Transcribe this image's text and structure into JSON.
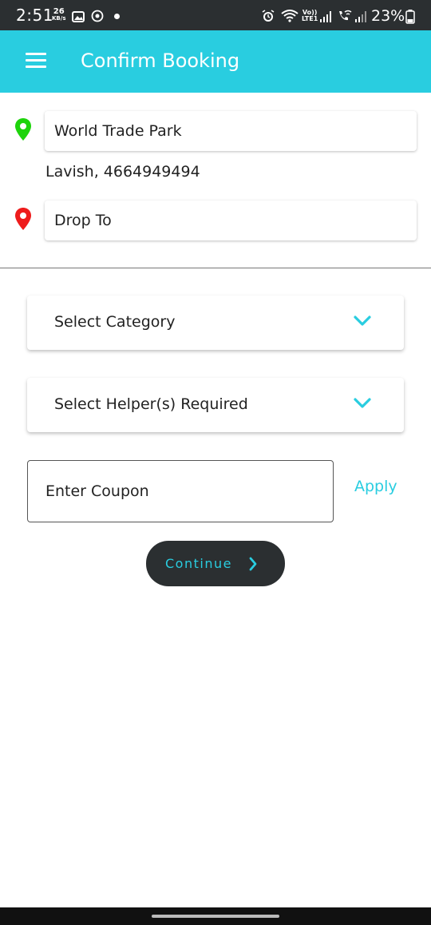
{
  "status_bar": {
    "time": "2:51",
    "speed_value": "26",
    "speed_unit": "KB/s",
    "volte_top": "Vo))",
    "volte_bottom": "LTE1",
    "battery_percent": "23%"
  },
  "app_bar": {
    "title": "Confirm Booking",
    "menu_icon": "hamburger-menu-icon",
    "color": "#29cde0"
  },
  "pickup": {
    "pin_icon": "location-pin-icon",
    "pin_color": "#1ed40c",
    "address": "World Trade Park",
    "contact": "Lavish, 4664949494"
  },
  "drop": {
    "pin_icon": "location-pin-icon",
    "pin_color": "#ee1c1c",
    "placeholder": "Drop To"
  },
  "category_dropdown": {
    "label": "Select Category",
    "icon": "chevron-down-icon"
  },
  "helpers_dropdown": {
    "label": "Select Helper(s) Required",
    "icon": "chevron-down-icon"
  },
  "coupon": {
    "placeholder": "Enter Coupon",
    "apply_label": "Apply"
  },
  "continue_button": {
    "label": "Continue",
    "icon": "chevron-right-icon"
  },
  "colors": {
    "accent": "#29cde0",
    "dark": "#2b2f31"
  }
}
